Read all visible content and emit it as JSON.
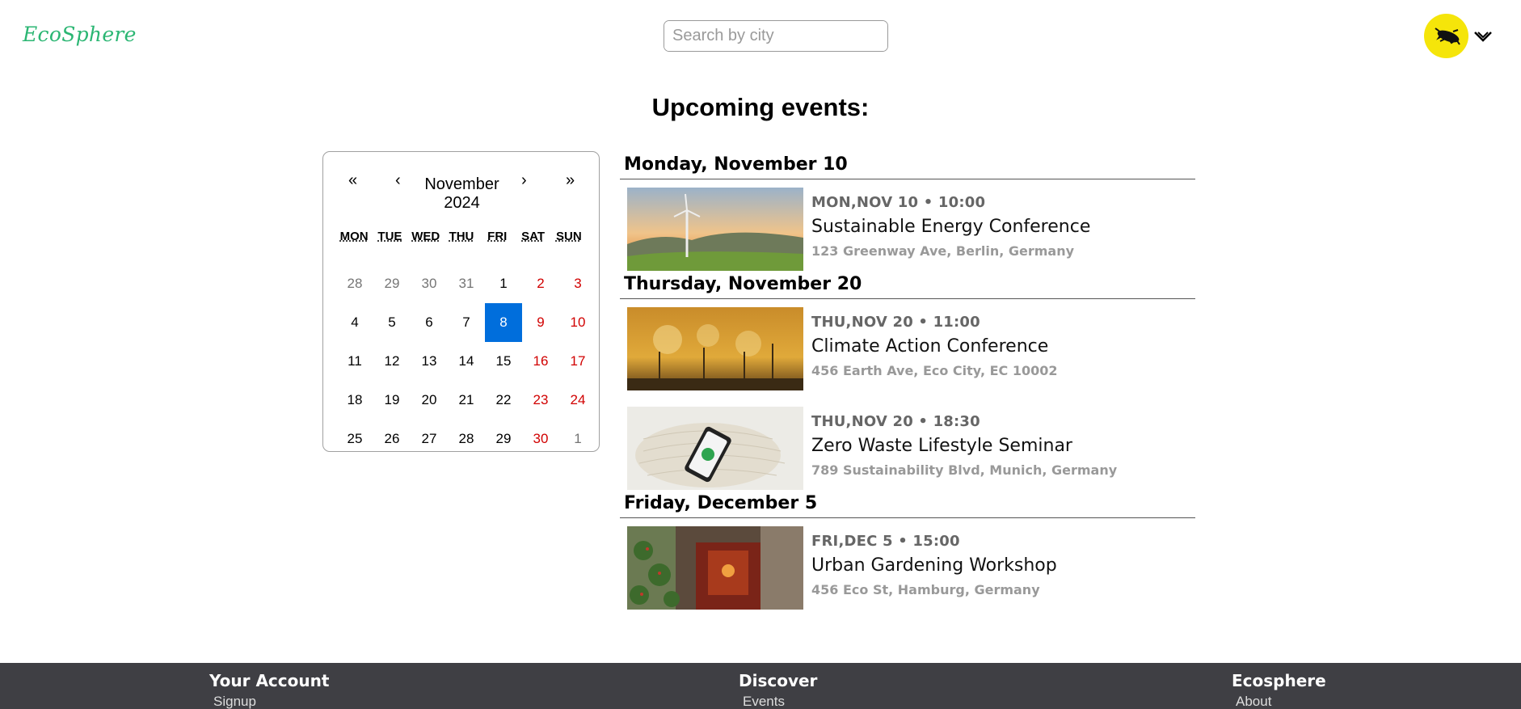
{
  "app": {
    "logo": "EcoSphere"
  },
  "search": {
    "placeholder": "Search by city",
    "value": "",
    "icon": "search-icon"
  },
  "user": {
    "avatar_icon": "avatar-icon",
    "menu_icon": "chevron-down-icon"
  },
  "page": {
    "title": "Upcoming events:"
  },
  "calendar": {
    "prev_year": "«",
    "prev_month": "‹",
    "month": "November",
    "year": "2024",
    "next_month": "›",
    "next_year": "»",
    "weekdays": [
      "MON",
      "TUE",
      "WED",
      "THU",
      "FRI",
      "SAT",
      "SUN"
    ],
    "selected_day": "8",
    "colors": {
      "weekend": "#d10000",
      "other_month": "#757575",
      "selected": "#006edc"
    },
    "days": [
      {
        "label": "28",
        "kind": "other"
      },
      {
        "label": "29",
        "kind": "other"
      },
      {
        "label": "30",
        "kind": "other"
      },
      {
        "label": "31",
        "kind": "other"
      },
      {
        "label": "1",
        "kind": "normal"
      },
      {
        "label": "2",
        "kind": "weekend"
      },
      {
        "label": "3",
        "kind": "weekend"
      },
      {
        "label": "4",
        "kind": "normal"
      },
      {
        "label": "5",
        "kind": "normal"
      },
      {
        "label": "6",
        "kind": "normal"
      },
      {
        "label": "7",
        "kind": "normal"
      },
      {
        "label": "8",
        "kind": "selected"
      },
      {
        "label": "9",
        "kind": "weekend"
      },
      {
        "label": "10",
        "kind": "weekend"
      },
      {
        "label": "11",
        "kind": "normal"
      },
      {
        "label": "12",
        "kind": "normal"
      },
      {
        "label": "13",
        "kind": "normal"
      },
      {
        "label": "14",
        "kind": "normal"
      },
      {
        "label": "15",
        "kind": "normal"
      },
      {
        "label": "16",
        "kind": "weekend"
      },
      {
        "label": "17",
        "kind": "weekend"
      },
      {
        "label": "18",
        "kind": "normal"
      },
      {
        "label": "19",
        "kind": "normal"
      },
      {
        "label": "20",
        "kind": "normal"
      },
      {
        "label": "21",
        "kind": "normal"
      },
      {
        "label": "22",
        "kind": "normal"
      },
      {
        "label": "23",
        "kind": "weekend"
      },
      {
        "label": "24",
        "kind": "weekend"
      },
      {
        "label": "25",
        "kind": "normal"
      },
      {
        "label": "26",
        "kind": "normal"
      },
      {
        "label": "27",
        "kind": "normal"
      },
      {
        "label": "28",
        "kind": "normal"
      },
      {
        "label": "29",
        "kind": "normal"
      },
      {
        "label": "30",
        "kind": "weekend"
      },
      {
        "label": "1",
        "kind": "other"
      }
    ]
  },
  "event_groups": [
    {
      "date": "Monday, November 10",
      "events": [
        {
          "datetime": "MON,NOV 10 • 10:00",
          "title": "Sustainable Energy Conference",
          "address": "123 Greenway Ave, Berlin, Germany",
          "image": "wind-turbine-sunset-image"
        }
      ]
    },
    {
      "date": "Thursday, November 20",
      "events": [
        {
          "datetime": "THU,NOV 20 • 11:00",
          "title": "Climate Action Conference",
          "address": "456 Earth Ave, Eco City, EC 10002",
          "image": "factory-smoke-image"
        },
        {
          "datetime": "THU,NOV 20 • 18:30",
          "title": "Zero Waste Lifestyle Seminar",
          "address": "789 Sustainability Blvd, Munich, Germany",
          "image": "phone-on-net-bag-image"
        }
      ]
    },
    {
      "date": "Friday, December 5",
      "events": [
        {
          "datetime": "FRI,DEC 5 • 15:00",
          "title": "Urban Gardening Workshop",
          "address": "456 Eco St, Hamburg, Germany",
          "image": "plant-storefront-image"
        }
      ]
    }
  ],
  "footer": {
    "columns": [
      {
        "heading": "Your Account",
        "link": "Signup"
      },
      {
        "heading": "Discover",
        "link": "Events"
      },
      {
        "heading": "Ecosphere",
        "link": "About"
      }
    ]
  },
  "colors": {
    "brand": "#2bb673",
    "search_button": "#f0466b",
    "avatar_bg": "#f5e50a",
    "footer_bg": "#3f3f44"
  }
}
